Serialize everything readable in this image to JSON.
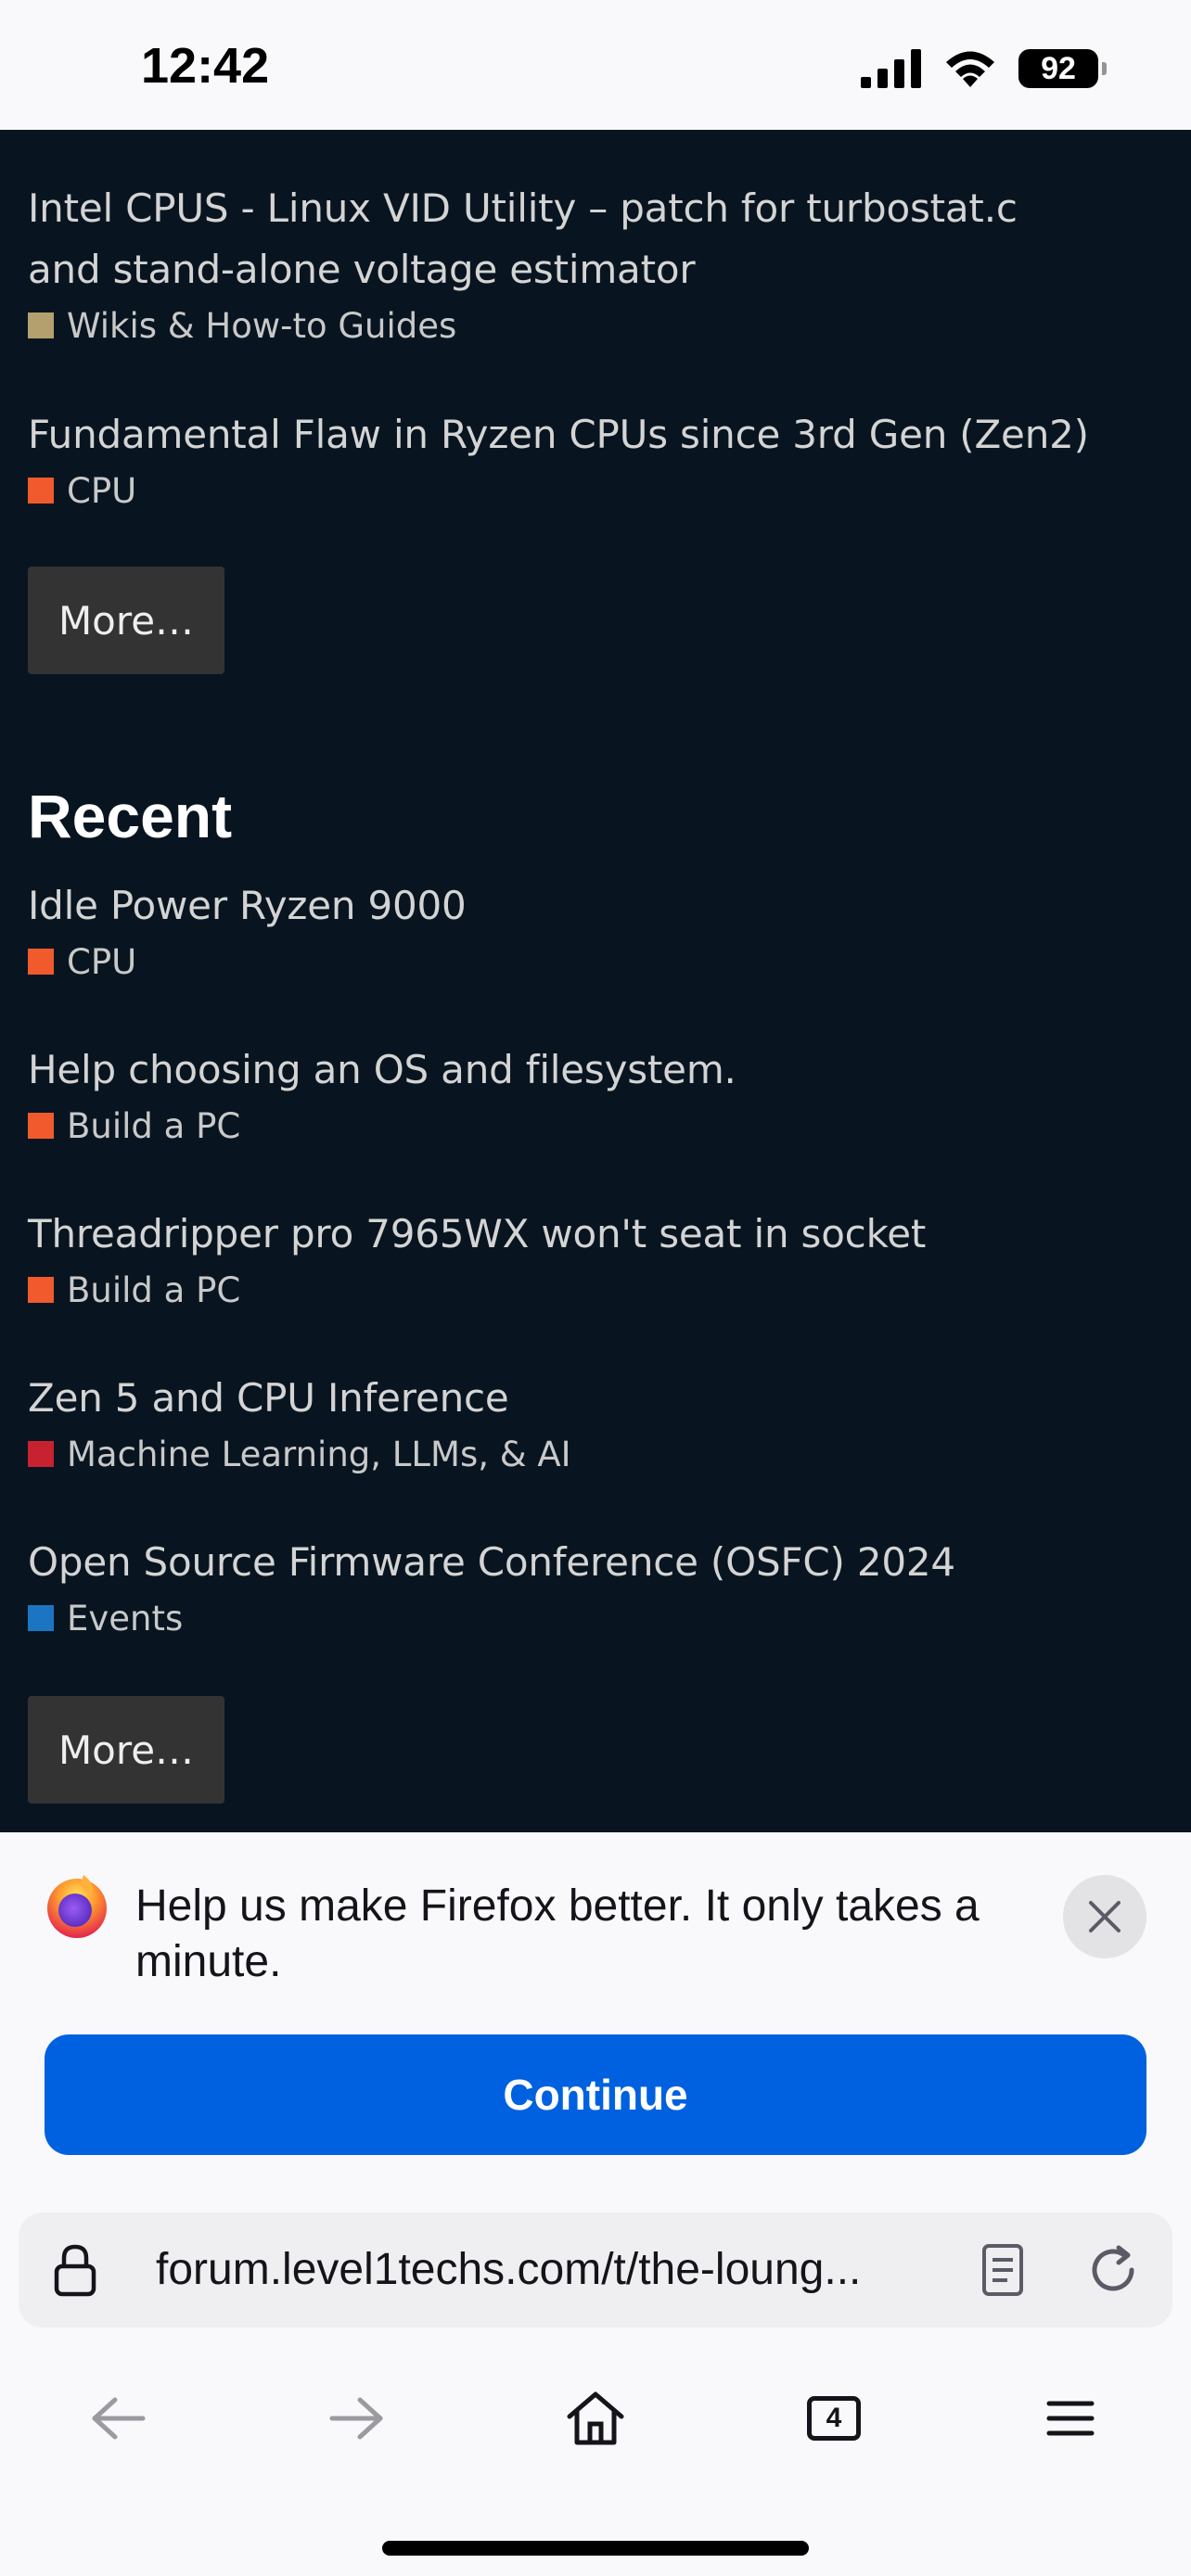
{
  "status_bar": {
    "time": "12:42",
    "battery": "92",
    "icons": [
      "cellular-signal-icon",
      "wifi-icon",
      "battery-icon"
    ]
  },
  "page": {
    "suggested_topics": [
      {
        "title": "Intel CPUS - Linux VID Utility – patch for turbostat.c and stand-alone voltage estimator",
        "title_line1": "Intel CPUS - Linux VID Utility – patch for turbostat.c",
        "title_line2": "and stand-alone voltage estimator",
        "category": "Wikis & How-to Guides",
        "category_color": "#b3a06e"
      },
      {
        "title": "Fundamental Flaw in Ryzen CPUs since 3rd Gen (Zen2)",
        "category": "CPU",
        "category_color": "#f05a2c"
      }
    ],
    "more_label_1": "More…",
    "recent_heading": "Recent",
    "recent_topics": [
      {
        "title": "Idle Power Ryzen 9000",
        "category": "CPU",
        "category_color": "#f05a2c"
      },
      {
        "title": "Help choosing an OS and filesystem.",
        "category": "Build a PC",
        "category_color": "#f05a2c"
      },
      {
        "title": "Threadripper pro 7965WX won't seat in socket",
        "category": "Build a PC",
        "category_color": "#f05a2c"
      },
      {
        "title": "Zen 5 and CPU Inference",
        "category": "Machine Learning, LLMs, & AI",
        "category_color": "#c8212f"
      },
      {
        "title": "Open Source Firmware Conference (OSFC) 2024",
        "category": "Events",
        "category_color": "#1b75c2"
      }
    ],
    "more_label_2": "More…",
    "background_color": "#081520"
  },
  "firefox": {
    "survey_text": "Help us make Firefox better. It only takes a minute.",
    "continue_label": "Continue",
    "accent_color": "#0061e0",
    "url": "forum.level1techs.com/t/the-loung...",
    "tab_count": "4",
    "nav_icons": [
      "back-arrow-icon",
      "forward-arrow-icon",
      "home-icon",
      "tabs-icon",
      "menu-icon"
    ]
  }
}
